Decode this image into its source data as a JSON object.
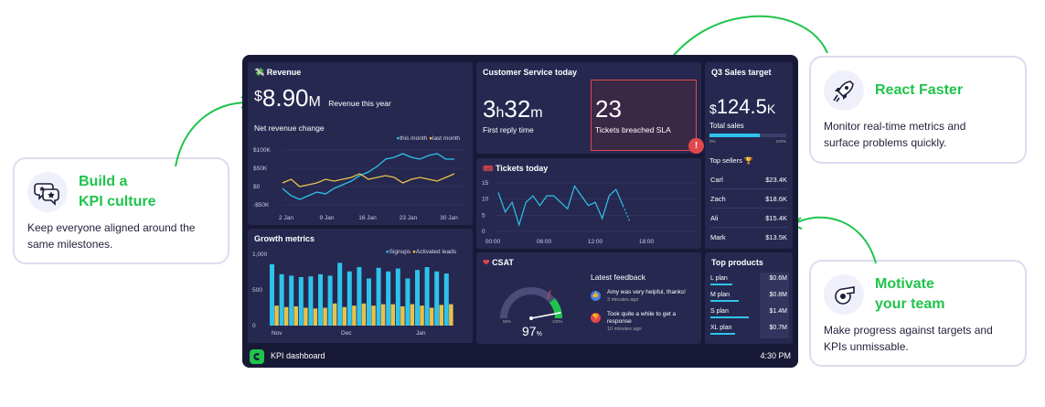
{
  "callouts": {
    "kpi_culture": {
      "title_line1": "Build a",
      "title_line2": "KPI culture",
      "desc_line1": "Keep everyone aligned around the",
      "desc_line2": "same milestones."
    },
    "react_faster": {
      "title": "React Faster",
      "desc_line1": "Monitor real-time metrics and",
      "desc_line2": "surface problems quickly."
    },
    "motivate": {
      "title_line1": "Motivate",
      "title_line2": "your team",
      "desc_line1": "Make progress against targets and",
      "desc_line2": "KPIs unmissable."
    }
  },
  "revenue": {
    "title": "Revenue",
    "currency": "$",
    "value": "8.90",
    "unit": "M",
    "caption": "Revenue this year",
    "chart_title": "Net revenue change",
    "legend_this": "this month",
    "legend_last": "last month",
    "y_ticks": [
      "$100K",
      "$50K",
      "$0",
      "-$50K"
    ],
    "x_ticks": [
      "2 Jan",
      "9 Jan",
      "16 Jan",
      "23 Jan",
      "30 Jan"
    ]
  },
  "customer_service": {
    "title": "Customer Service today",
    "reply_h": "3",
    "reply_h_unit": "h",
    "reply_m": "32",
    "reply_m_unit": "m",
    "reply_label": "First reply time",
    "breached_value": "23",
    "breached_label": "Tickets breached SLA",
    "alert_symbol": "!"
  },
  "q3_sales": {
    "title": "Q3 Sales target",
    "currency": "$",
    "value": "124.5",
    "unit": "K",
    "caption": "Total sales",
    "bar_left": "0%",
    "bar_right": "100%",
    "progress": 0.66,
    "top_sellers_label": "Top sellers",
    "sellers": [
      {
        "name": "Carl",
        "value": "$23.4K"
      },
      {
        "name": "Zach",
        "value": "$18.6K"
      },
      {
        "name": "Ali",
        "value": "$15.4K"
      },
      {
        "name": "Mark",
        "value": "$13.5K"
      }
    ]
  },
  "tickets_today": {
    "title": "Tickets today",
    "y_ticks": [
      "15",
      "10",
      "5",
      "0"
    ],
    "x_ticks": [
      "00:00",
      "06:00",
      "12:00",
      "18:00"
    ]
  },
  "growth": {
    "title": "Growth metrics",
    "legend_signups": "Signups",
    "legend_leads": "Activated leads",
    "y_ticks": [
      "1,000",
      "500",
      "0"
    ],
    "x_ticks": [
      "Nov",
      "Dec",
      "Jan"
    ]
  },
  "csat": {
    "title": "CSAT",
    "value": "97",
    "unit": "%",
    "gauge_min": "50%",
    "gauge_max": "100%",
    "feedback_title": "Latest feedback",
    "feedback": [
      {
        "text_line1": "Amy was very helpful, thanks!",
        "text_line2": "",
        "time": "3 minutes ago"
      },
      {
        "text_line1": "Took quite a while to get a",
        "text_line2": "response",
        "time": "10 minutes ago"
      }
    ]
  },
  "top_products": {
    "title": "Top products",
    "items": [
      {
        "name": "L plan",
        "value": "$0.6M",
        "share": 0.55
      },
      {
        "name": "M plan",
        "value": "$0.8M",
        "share": 0.7
      },
      {
        "name": "S plan",
        "value": "$1.4M",
        "share": 0.95
      },
      {
        "name": "XL plan",
        "value": "$0.7M",
        "share": 0.62
      }
    ]
  },
  "footer": {
    "title": "KPI dashboard",
    "time": "4:30 PM"
  },
  "chart_data": [
    {
      "type": "line",
      "title": "Net revenue change",
      "x": [
        "2 Jan",
        "9 Jan",
        "16 Jan",
        "23 Jan",
        "30 Jan"
      ],
      "ylim": [
        -60,
        110
      ],
      "series": [
        {
          "name": "this month",
          "color": "#2fc3ea",
          "values": [
            -5,
            -25,
            -35,
            -25,
            -15,
            -20,
            -5,
            5,
            15,
            30,
            40,
            55,
            75,
            80,
            90,
            80,
            75,
            85,
            90,
            75,
            75
          ]
        },
        {
          "name": "last month",
          "color": "#e8c14a",
          "values": [
            10,
            20,
            0,
            5,
            10,
            20,
            15,
            20,
            25,
            35,
            20,
            25,
            30,
            25,
            10,
            20,
            25,
            20,
            15,
            25,
            35
          ]
        }
      ]
    },
    {
      "type": "line",
      "title": "Tickets today",
      "x": [
        "00:00",
        "06:00",
        "12:00",
        "18:00"
      ],
      "ylim": [
        0,
        15
      ],
      "series": [
        {
          "name": "",
          "color": "#2fc3ea",
          "values": [
            12,
            6,
            9,
            2,
            9,
            11,
            8,
            11,
            11,
            9,
            7,
            14,
            11,
            8,
            9,
            4,
            11,
            13,
            8,
            3
          ]
        }
      ]
    },
    {
      "type": "bar",
      "title": "Growth metrics",
      "ylim": [
        0,
        1000
      ],
      "series": [
        {
          "name": "Signups",
          "color": "#2fc3ea",
          "values": [
            860,
            720,
            700,
            680,
            690,
            720,
            700,
            880,
            760,
            820,
            660,
            810,
            760,
            800,
            660,
            780,
            820,
            760,
            730
          ]
        },
        {
          "name": "Activated leads",
          "color": "#e8c14a",
          "values": [
            280,
            260,
            270,
            250,
            240,
            250,
            310,
            260,
            280,
            310,
            280,
            300,
            300,
            270,
            300,
            280,
            250,
            290,
            300
          ]
        }
      ]
    },
    {
      "type": "gauge",
      "title": "CSAT",
      "value": 97,
      "min": 50,
      "max": 100
    }
  ],
  "colors": {
    "accent_green": "#1fc44b",
    "dashboard_bg": "#181936",
    "panel_bg": "#262850",
    "cyan": "#2fc3ea",
    "yellow": "#e8c14a",
    "alert_red": "#e2474e"
  }
}
